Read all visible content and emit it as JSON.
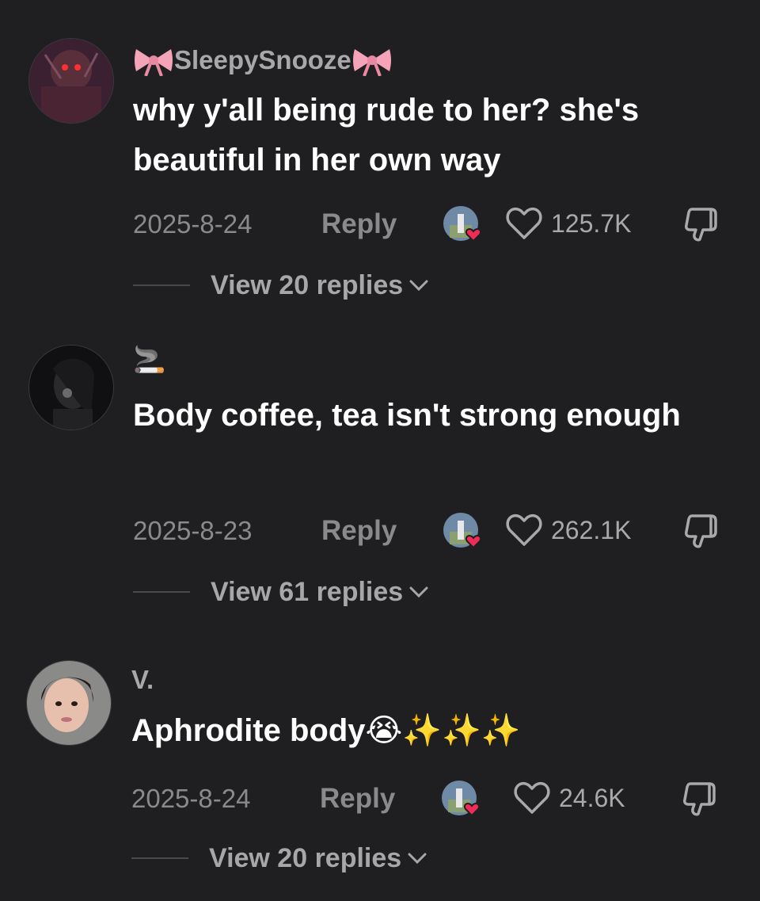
{
  "comments": [
    {
      "username": "SleepySnooze",
      "text": "why y'all being rude to her? she's beautiful in her own way",
      "date": "2025-8-24",
      "reply_label": "Reply",
      "likes": "125.7K",
      "view_replies": "View 20 replies"
    },
    {
      "username": "🚬",
      "text": "Body coffee, tea isn't strong enough",
      "date": "2025-8-23",
      "reply_label": "Reply",
      "likes": "262.1K",
      "view_replies": "View 61 replies"
    },
    {
      "username": "V.",
      "text": "Aphrodite body😭✨✨✨",
      "date": "2025-8-24",
      "reply_label": "Reply",
      "likes": "24.6K",
      "view_replies": "View 20 replies"
    }
  ],
  "icons": {
    "like": "heart-outline-icon",
    "dislike": "thumbs-down-icon",
    "creator_liked": "creator-liked-badge",
    "expand": "chevron-down-icon",
    "name_decoration": "pink-bow-icon"
  },
  "colors": {
    "background": "#1f1f21",
    "text_primary": "#ffffff",
    "text_secondary": "#8a8a8c",
    "heart_badge": "#f02c56",
    "bow": "#f4a3b8"
  }
}
